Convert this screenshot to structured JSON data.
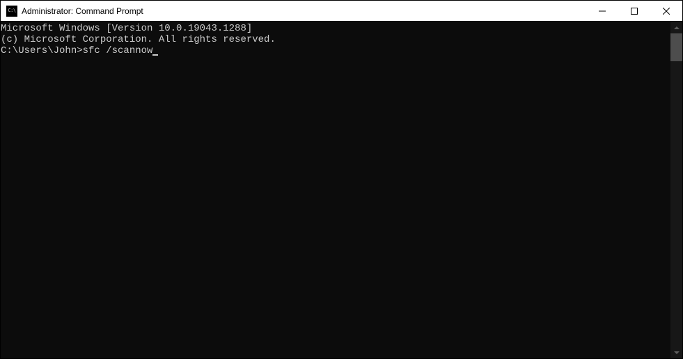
{
  "window": {
    "title": "Administrator: Command Prompt",
    "icon_text": "C:\\"
  },
  "terminal": {
    "line1": "Microsoft Windows [Version 10.0.19043.1288]",
    "line2": "(c) Microsoft Corporation. All rights reserved.",
    "blank": "",
    "prompt": "C:\\Users\\John>",
    "command": "sfc /scannow"
  }
}
